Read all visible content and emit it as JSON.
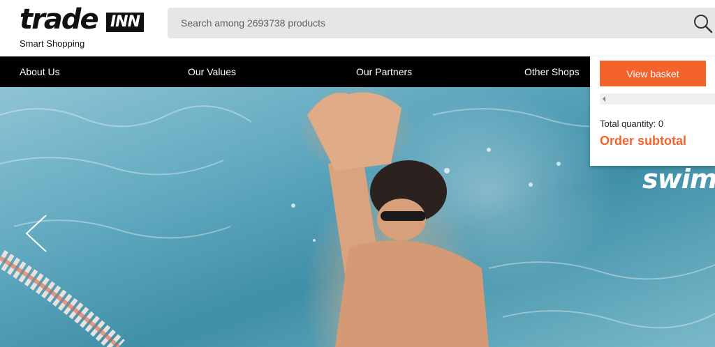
{
  "header": {
    "logo_word": "trade",
    "logo_box": "INN",
    "tagline": "Smart Shopping"
  },
  "search": {
    "placeholder": "Search among 2693738 products",
    "icon": "search-icon"
  },
  "nav": {
    "items": [
      {
        "label": "About Us"
      },
      {
        "label": "Our Values"
      },
      {
        "label": "Our Partners"
      },
      {
        "label": "Other Shops"
      }
    ]
  },
  "hero": {
    "brand_text": "swim",
    "prev_icon": "chevron-left-icon"
  },
  "basket": {
    "view_basket_label": "View basket",
    "total_quantity": "Total quantity: 0",
    "order_subtotal": "Order subtotal"
  },
  "colors": {
    "accent": "#f3632b",
    "nav_bg": "#000000",
    "search_bg": "#e6e6e6"
  }
}
